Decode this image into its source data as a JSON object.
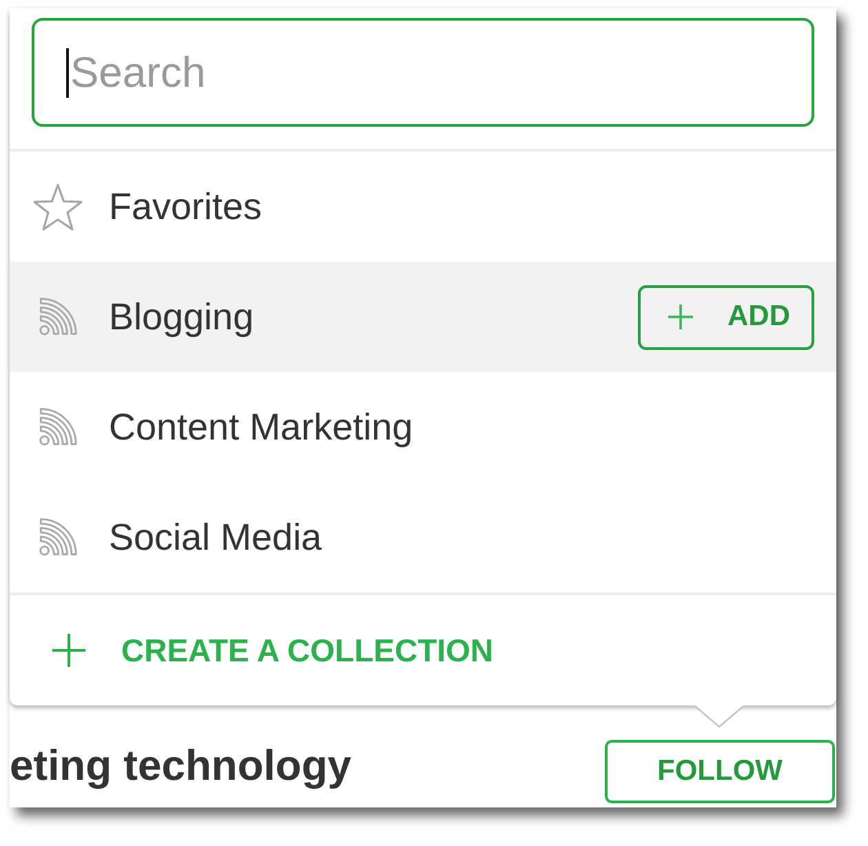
{
  "search": {
    "placeholder": "Search"
  },
  "collections": [
    {
      "kind": "favorites",
      "name": "Favorites",
      "selected": false
    },
    {
      "kind": "feed",
      "name": "Blogging",
      "selected": true,
      "action": "ADD"
    },
    {
      "kind": "feed",
      "name": "Content Marketing",
      "selected": false
    },
    {
      "kind": "feed",
      "name": "Social Media",
      "selected": false
    }
  ],
  "create_collection": {
    "label": "CREATE A COLLECTION"
  },
  "page": {
    "title": "eting technology",
    "follow_button": "FOLLOW"
  }
}
